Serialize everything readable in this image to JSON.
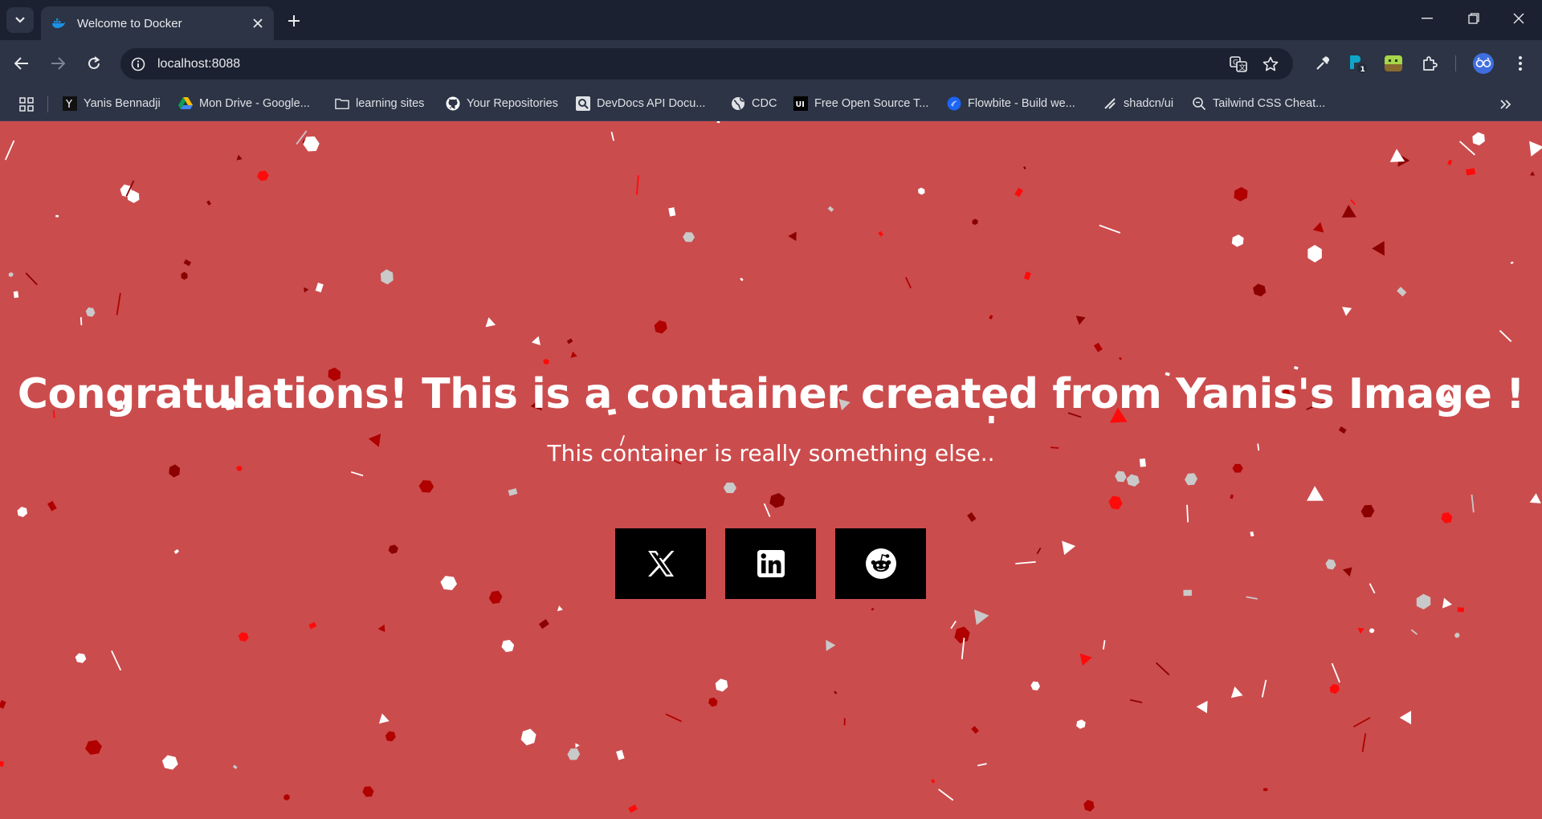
{
  "browser": {
    "tab": {
      "title": "Welcome to Docker",
      "favicon": "docker-icon"
    },
    "address": {
      "url": "localhost:8088"
    },
    "extension_badge": "1",
    "bookmarks": [
      {
        "label": "Yanis Bennadji",
        "icon": "y-letter-icon"
      },
      {
        "label": "Mon Drive - Google...",
        "icon": "google-drive-icon"
      },
      {
        "label": "learning sites",
        "icon": "folder-icon"
      },
      {
        "label": "Your Repositories",
        "icon": "github-icon"
      },
      {
        "label": "DevDocs API Docu...",
        "icon": "devdocs-icon"
      },
      {
        "label": "CDC",
        "icon": "globe-icon"
      },
      {
        "label": "Free Open Source T...",
        "icon": "ui-letters-icon"
      },
      {
        "label": "Flowbite - Build we...",
        "icon": "flowbite-icon"
      },
      {
        "label": "shadcn/ui",
        "icon": "shadcn-icon"
      },
      {
        "label": "Tailwind CSS Cheat...",
        "icon": "search-doc-icon"
      }
    ]
  },
  "page": {
    "headline": "Congratulations! This is a container created from Yanis's Image !",
    "subline": "This container is really something else..",
    "background_color": "#cb4c4d",
    "social_buttons": [
      {
        "name": "x-button",
        "icon": "x-logo-icon"
      },
      {
        "name": "linkedin-button",
        "icon": "linkedin-icon"
      },
      {
        "name": "reddit-button",
        "icon": "reddit-icon"
      }
    ]
  }
}
